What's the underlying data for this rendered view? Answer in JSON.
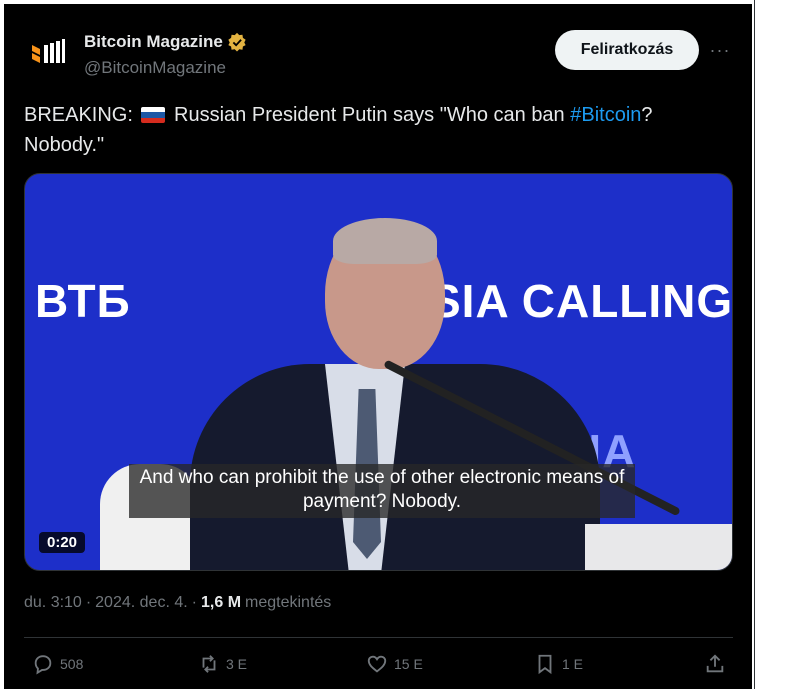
{
  "author": {
    "name": "Bitcoin Magazine",
    "handle": "@BitcoinMagazine",
    "verified": true,
    "icon": "bitcoin-magazine-logo"
  },
  "subscribe_label": "Feliratkozás",
  "more_label": "···",
  "tweet": {
    "prefix": "BREAKING:",
    "flag": "russia-flag",
    "body": "Russian President Putin says \"Who can ban ",
    "hashtag": "#Bitcoin",
    "suffix": "? Nobody.\""
  },
  "media": {
    "subtitle": "And who can prohibit the use of other electronic means of payment? Nobody.",
    "duration": "0:20",
    "bg_left": "ВТБ",
    "bg_right": "SIA CALLING",
    "bg_lower": "SSIA"
  },
  "meta": {
    "time": "du. 3:10",
    "sep1": "·",
    "date": "2024. dec. 4.",
    "sep2": "·",
    "views": "1,6 M",
    "views_label": "megtekintés"
  },
  "actions": {
    "replies": "508",
    "reposts": "3 E",
    "likes": "15 E",
    "bookmarks": "1 E"
  },
  "colors": {
    "background": "#000000",
    "accent": "#1d9bf0",
    "verified": "#e3b341",
    "muted": "#71767b",
    "media_bg": "#1d2fc9"
  }
}
